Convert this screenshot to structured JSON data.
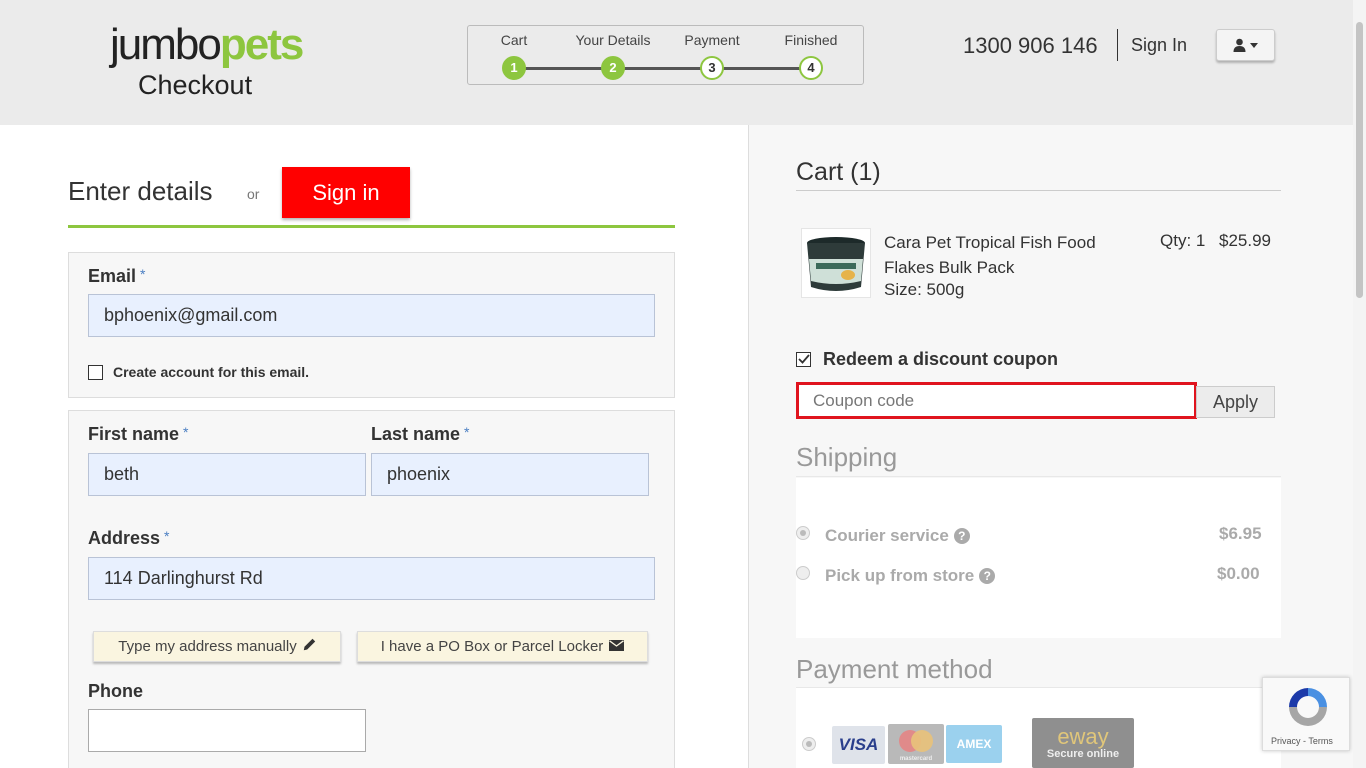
{
  "header": {
    "logo_jumbo": "jumbo",
    "logo_pets": "pets",
    "logo_sub": "Checkout",
    "steps": [
      {
        "label": "Cart",
        "num": "1",
        "state": "done"
      },
      {
        "label": "Your Details",
        "num": "2",
        "state": "done"
      },
      {
        "label": "Payment",
        "num": "3",
        "state": "todo"
      },
      {
        "label": "Finished",
        "num": "4",
        "state": "todo"
      }
    ],
    "phone": "1300 906 146",
    "sign_in": "Sign In",
    "user_icon": "user-icon"
  },
  "details": {
    "title": "Enter details",
    "or": "or",
    "sign_in_button": "Sign in",
    "email_label": "Email",
    "required_mark": "*",
    "email_value": "bphoenix@gmail.com",
    "create_account": "Create account for this email.",
    "first_name_label": "First name",
    "first_name_value": "beth",
    "last_name_label": "Last name",
    "last_name_value": "phoenix",
    "address_label": "Address",
    "address_value": "114 Darlinghurst Rd",
    "manual_btn": "Type my address manually",
    "pobox_btn": "I have a PO Box or Parcel Locker",
    "phone_label": "Phone",
    "phone_value": ""
  },
  "cart": {
    "title": "Cart (1)",
    "item": {
      "name": "Cara Pet Tropical Fish Food Flakes Bulk Pack",
      "size": "Size: 500g",
      "qty": "Qty: 1",
      "price": "$25.99"
    },
    "redeem_label": "Redeem a discount coupon",
    "coupon_placeholder": "Coupon code",
    "apply": "Apply"
  },
  "shipping": {
    "title": "Shipping",
    "options": [
      {
        "label": "Courier service",
        "price": "$6.95",
        "selected": true
      },
      {
        "label": "Pick up from store",
        "price": "$0.00",
        "selected": false
      }
    ]
  },
  "payment": {
    "title": "Payment method",
    "visa": "VISA",
    "mastercard": "mastercard",
    "amex": "AMEX",
    "eway": "eway",
    "eway_sub": "Secure online"
  },
  "recaptcha": {
    "privacy": "Privacy",
    "sep": " - ",
    "terms": "Terms"
  },
  "colors": {
    "brand_green": "#8dc63f",
    "signin_red": "#ff0000",
    "coupon_highlight": "#e0141e"
  }
}
